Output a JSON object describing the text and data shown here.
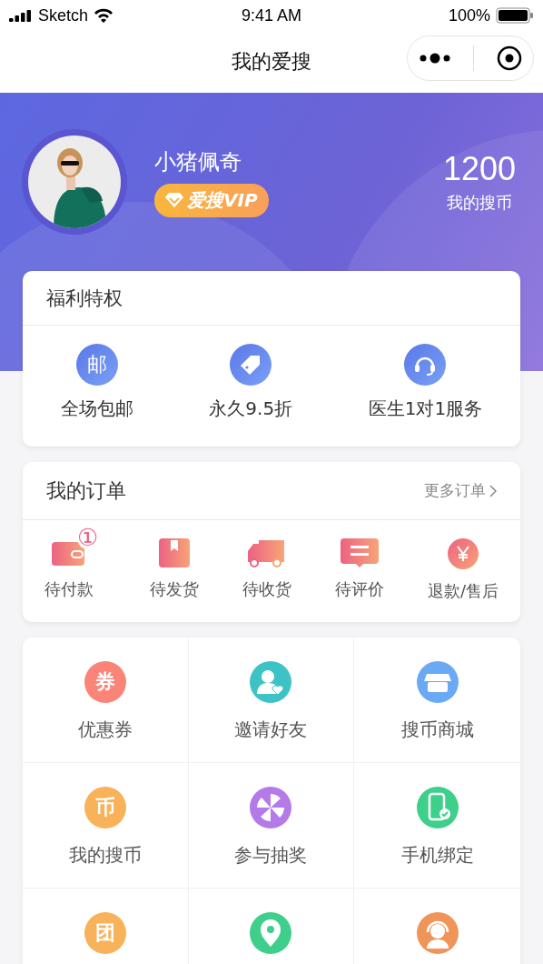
{
  "status_bar": {
    "carrier": "Sketch",
    "time": "9:41 AM",
    "battery": "100%"
  },
  "nav": {
    "title": "我的爱搜"
  },
  "profile": {
    "name": "小猪佩奇",
    "badge": "爱搜VIP",
    "coins": "1200",
    "coins_label": "我的搜币"
  },
  "benefits": {
    "title": "福利特权",
    "items": [
      {
        "kind": "glyph",
        "glyph": "邮",
        "label": "全场包邮"
      },
      {
        "kind": "tag",
        "label": "永久9.5折"
      },
      {
        "kind": "headset",
        "label": "医生1对1服务"
      }
    ]
  },
  "orders": {
    "title": "我的订单",
    "more": "更多订单",
    "items": [
      {
        "kind": "wallet",
        "label": "待付款",
        "badge": "①"
      },
      {
        "kind": "book",
        "label": "待发货"
      },
      {
        "kind": "truck",
        "label": "待收货"
      },
      {
        "kind": "comment",
        "label": "待评价"
      },
      {
        "kind": "yen",
        "label": "退款/售后"
      }
    ]
  },
  "services": [
    {
      "kind": "glyph",
      "glyph": "券",
      "label": "优惠券",
      "color": "#fa8478"
    },
    {
      "kind": "friend",
      "label": "邀请好友",
      "color": "#3dc3c6"
    },
    {
      "kind": "shop",
      "label": "搜币商城",
      "color": "#6aaaf5"
    },
    {
      "kind": "glyph",
      "glyph": "币",
      "label": "我的搜币",
      "color": "#f8b25a"
    },
    {
      "kind": "pinwheel",
      "label": "参与抽奖",
      "color": "#b47ae8"
    },
    {
      "kind": "phone",
      "label": "手机绑定",
      "color": "#3ecf8a"
    },
    {
      "kind": "glyph",
      "glyph": "团",
      "color": "#f8b25a"
    },
    {
      "kind": "pin",
      "color": "#3ecf8a"
    },
    {
      "kind": "agent",
      "color": "#f0955a"
    }
  ]
}
